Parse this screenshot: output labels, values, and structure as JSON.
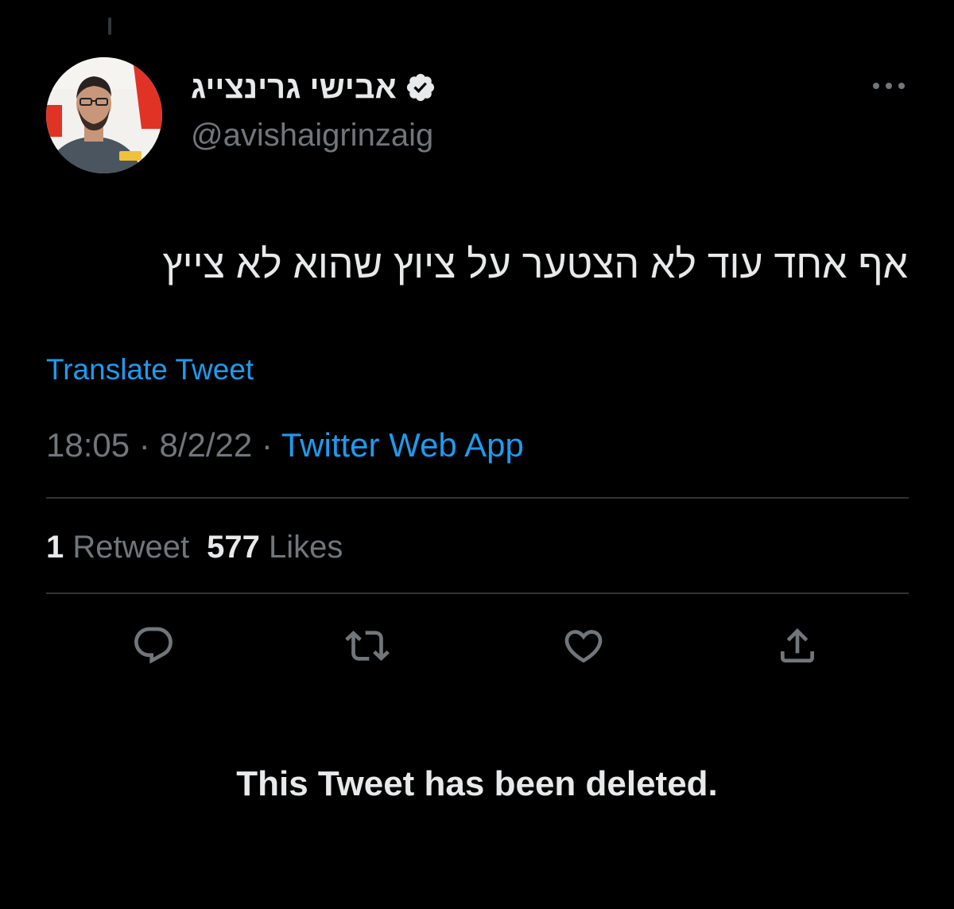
{
  "author": {
    "display_name": "אבישי גרינצייג",
    "handle": "@avishaigrinzaig",
    "verified": true,
    "avatar_icon": "profile-photo"
  },
  "header": {
    "more_icon": "ellipsis-icon"
  },
  "tweet": {
    "text": "אף אחד עוד לא הצטער על ציוץ שהוא לא צייץ",
    "translate_label": "Translate Tweet",
    "time": "18:05",
    "separator": "·",
    "date": "8/2/22",
    "source": "Twitter Web App"
  },
  "stats": {
    "retweets_count": "1",
    "retweets_label": "Retweet",
    "likes_count": "577",
    "likes_label": "Likes"
  },
  "actions": {
    "reply_icon": "reply-icon",
    "retweet_icon": "retweet-icon",
    "like_icon": "heart-icon",
    "share_icon": "share-icon"
  },
  "notice": {
    "deleted_text": "This Tweet has been deleted."
  },
  "colors": {
    "background": "#000000",
    "text_primary": "#e7e9ea",
    "text_secondary": "#71767b",
    "link": "#1d9bf0",
    "divider": "#2f3336"
  }
}
